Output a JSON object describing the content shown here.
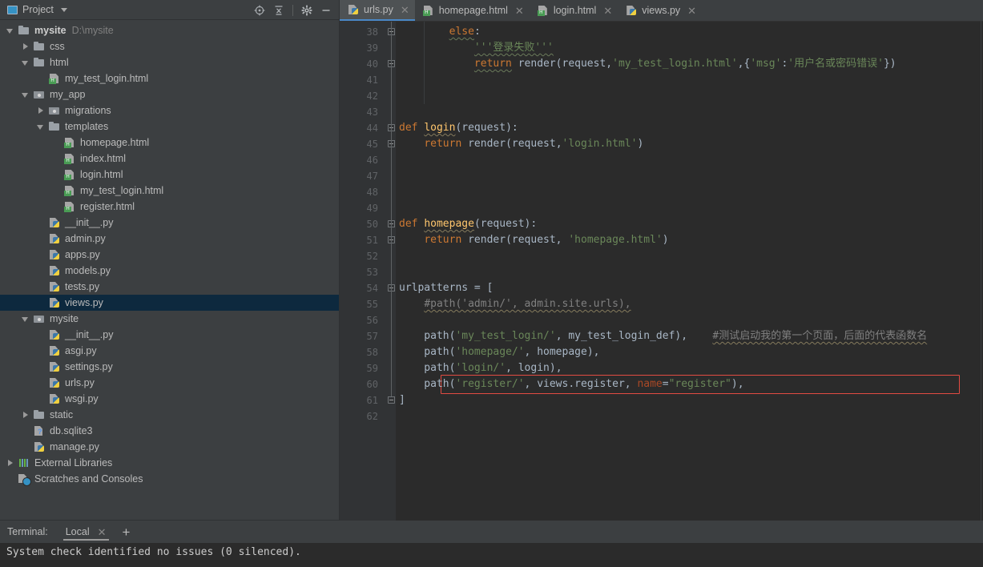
{
  "project_panel": {
    "title": "Project",
    "window_icon": "project-window-icon",
    "dropdown_icon": "chevron-down-icon",
    "tools": [
      {
        "name": "locate-icon",
        "label": "Select Opened File"
      },
      {
        "name": "collapse-all-icon",
        "label": "Collapse All"
      },
      {
        "name": "gear-icon",
        "label": "Settings"
      },
      {
        "name": "minimize-icon",
        "label": "Hide"
      }
    ],
    "tree": [
      {
        "indent": 0,
        "twisty": "open",
        "icon": "folder-icon",
        "label": "mysite",
        "bold": true,
        "subpath": "D:\\mysite",
        "selected": false
      },
      {
        "indent": 1,
        "twisty": "closed",
        "icon": "folder-icon",
        "label": "css",
        "bold": false,
        "subpath": "",
        "selected": false
      },
      {
        "indent": 1,
        "twisty": "open",
        "icon": "folder-icon",
        "label": "html",
        "bold": false,
        "subpath": "",
        "selected": false
      },
      {
        "indent": 2,
        "twisty": "none",
        "icon": "html-file-icon",
        "label": "my_test_login.html",
        "bold": false,
        "subpath": "",
        "selected": false
      },
      {
        "indent": 1,
        "twisty": "open",
        "icon": "module-folder-icon",
        "label": "my_app",
        "bold": false,
        "subpath": "",
        "selected": false
      },
      {
        "indent": 2,
        "twisty": "closed",
        "icon": "module-folder-icon",
        "label": "migrations",
        "bold": false,
        "subpath": "",
        "selected": false
      },
      {
        "indent": 2,
        "twisty": "open",
        "icon": "folder-icon",
        "label": "templates",
        "bold": false,
        "subpath": "",
        "selected": false
      },
      {
        "indent": 3,
        "twisty": "none",
        "icon": "html-file-icon",
        "label": "homepage.html",
        "bold": false,
        "subpath": "",
        "selected": false
      },
      {
        "indent": 3,
        "twisty": "none",
        "icon": "html-file-icon",
        "label": "index.html",
        "bold": false,
        "subpath": "",
        "selected": false
      },
      {
        "indent": 3,
        "twisty": "none",
        "icon": "html-file-icon",
        "label": "login.html",
        "bold": false,
        "subpath": "",
        "selected": false
      },
      {
        "indent": 3,
        "twisty": "none",
        "icon": "html-file-icon",
        "label": "my_test_login.html",
        "bold": false,
        "subpath": "",
        "selected": false
      },
      {
        "indent": 3,
        "twisty": "none",
        "icon": "html-file-icon",
        "label": "register.html",
        "bold": false,
        "subpath": "",
        "selected": false
      },
      {
        "indent": 2,
        "twisty": "none",
        "icon": "python-file-icon",
        "label": "__init__.py",
        "bold": false,
        "subpath": "",
        "selected": false
      },
      {
        "indent": 2,
        "twisty": "none",
        "icon": "python-file-icon",
        "label": "admin.py",
        "bold": false,
        "subpath": "",
        "selected": false
      },
      {
        "indent": 2,
        "twisty": "none",
        "icon": "python-file-icon",
        "label": "apps.py",
        "bold": false,
        "subpath": "",
        "selected": false
      },
      {
        "indent": 2,
        "twisty": "none",
        "icon": "python-file-icon",
        "label": "models.py",
        "bold": false,
        "subpath": "",
        "selected": false
      },
      {
        "indent": 2,
        "twisty": "none",
        "icon": "python-file-icon",
        "label": "tests.py",
        "bold": false,
        "subpath": "",
        "selected": false
      },
      {
        "indent": 2,
        "twisty": "none",
        "icon": "python-file-icon",
        "label": "views.py",
        "bold": false,
        "subpath": "",
        "selected": true
      },
      {
        "indent": 1,
        "twisty": "open",
        "icon": "module-folder-icon",
        "label": "mysite",
        "bold": false,
        "subpath": "",
        "selected": false
      },
      {
        "indent": 2,
        "twisty": "none",
        "icon": "python-file-icon",
        "label": "__init__.py",
        "bold": false,
        "subpath": "",
        "selected": false
      },
      {
        "indent": 2,
        "twisty": "none",
        "icon": "python-file-icon",
        "label": "asgi.py",
        "bold": false,
        "subpath": "",
        "selected": false
      },
      {
        "indent": 2,
        "twisty": "none",
        "icon": "python-file-icon",
        "label": "settings.py",
        "bold": false,
        "subpath": "",
        "selected": false
      },
      {
        "indent": 2,
        "twisty": "none",
        "icon": "python-file-icon",
        "label": "urls.py",
        "bold": false,
        "subpath": "",
        "selected": false
      },
      {
        "indent": 2,
        "twisty": "none",
        "icon": "python-file-icon",
        "label": "wsgi.py",
        "bold": false,
        "subpath": "",
        "selected": false
      },
      {
        "indent": 1,
        "twisty": "closed",
        "icon": "folder-icon",
        "label": "static",
        "bold": false,
        "subpath": "",
        "selected": false
      },
      {
        "indent": 1,
        "twisty": "none",
        "icon": "db-file-icon",
        "label": "db.sqlite3",
        "bold": false,
        "subpath": "",
        "selected": false
      },
      {
        "indent": 1,
        "twisty": "none",
        "icon": "python-file-icon",
        "label": "manage.py",
        "bold": false,
        "subpath": "",
        "selected": false
      },
      {
        "indent": 0,
        "twisty": "closed",
        "icon": "library-icon",
        "label": "External Libraries",
        "bold": false,
        "subpath": "",
        "selected": false
      },
      {
        "indent": 0,
        "twisty": "none",
        "icon": "scratches-icon",
        "label": "Scratches and Consoles",
        "bold": false,
        "subpath": "",
        "selected": false
      }
    ]
  },
  "editor": {
    "tabs": [
      {
        "label": "urls.py",
        "icon": "python-file-icon",
        "active": true,
        "close_icon": "close-icon"
      },
      {
        "label": "homepage.html",
        "icon": "html-file-icon",
        "active": false,
        "close_icon": "close-icon"
      },
      {
        "label": "login.html",
        "icon": "html-file-icon",
        "active": false,
        "close_icon": "close-icon"
      },
      {
        "label": "views.py",
        "icon": "python-file-icon",
        "active": false,
        "close_icon": "close-icon"
      }
    ],
    "first_line_number": 38,
    "last_line_number": 62,
    "highlighted_line": 60,
    "highlight_color": "#e24b42",
    "lines": [
      {
        "n": 38,
        "text": "        else:"
      },
      {
        "n": 39,
        "text": "            '''登录失败'''"
      },
      {
        "n": 40,
        "text": "            return render(request,'my_test_login.html',{'msg':'用户名或密码错误'})"
      },
      {
        "n": 41,
        "text": ""
      },
      {
        "n": 42,
        "text": ""
      },
      {
        "n": 43,
        "text": ""
      },
      {
        "n": 44,
        "text": "def login(request):"
      },
      {
        "n": 45,
        "text": "    return render(request,'login.html')"
      },
      {
        "n": 46,
        "text": ""
      },
      {
        "n": 47,
        "text": ""
      },
      {
        "n": 48,
        "text": ""
      },
      {
        "n": 49,
        "text": ""
      },
      {
        "n": 50,
        "text": "def homepage(request):"
      },
      {
        "n": 51,
        "text": "    return render(request, 'homepage.html')"
      },
      {
        "n": 52,
        "text": ""
      },
      {
        "n": 53,
        "text": ""
      },
      {
        "n": 54,
        "text": "urlpatterns = ["
      },
      {
        "n": 55,
        "text": "    #path('admin/', admin.site.urls),"
      },
      {
        "n": 56,
        "text": ""
      },
      {
        "n": 57,
        "text": "    path('my_test_login/', my_test_login_def),    #测试启动我的第一个页面，后面的代表函数名"
      },
      {
        "n": 58,
        "text": "    path('homepage/', homepage),"
      },
      {
        "n": 59,
        "text": "    path('login/', login),"
      },
      {
        "n": 60,
        "text": "    path('register/', views.register, name=\"register\"),"
      },
      {
        "n": 61,
        "text": "]"
      },
      {
        "n": 62,
        "text": ""
      }
    ],
    "syntax_colors": {
      "keyword": "#cc7832",
      "string": "#6a8759",
      "comment": "#808080",
      "function": "#ffc66d",
      "identifier": "#a9b7c6",
      "kwarg": "#aa4926",
      "line_number": "#606366",
      "background": "#2b2b2b",
      "gutter_background": "#313335"
    }
  },
  "terminal": {
    "label": "Terminal:",
    "tabs": [
      {
        "label": "Local",
        "active": true,
        "close_icon": "close-icon"
      }
    ],
    "add_icon": "plus-icon",
    "output": "System check identified no issues (0 silenced)."
  }
}
